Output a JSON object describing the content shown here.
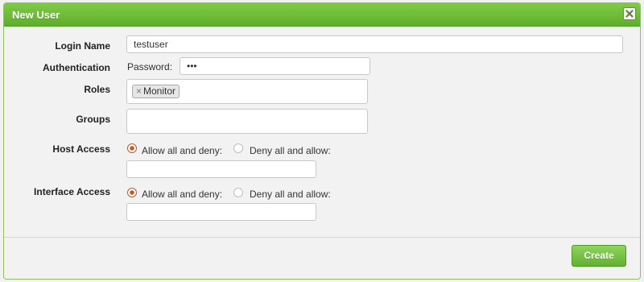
{
  "dialog": {
    "title": "New User",
    "close_icon": "close-icon"
  },
  "form": {
    "login_name": {
      "label": "Login Name",
      "value": "testuser"
    },
    "authentication": {
      "label": "Authentication",
      "password_label": "Password:",
      "password_value": "•••"
    },
    "roles": {
      "label": "Roles",
      "tags": [
        {
          "remove": "×",
          "text": "Monitor"
        }
      ]
    },
    "groups": {
      "label": "Groups",
      "value": ""
    },
    "host_access": {
      "label": "Host Access",
      "options": [
        {
          "text": "Allow all and deny:",
          "selected": true
        },
        {
          "text": "Deny all and allow:",
          "selected": false
        }
      ],
      "value": ""
    },
    "interface_access": {
      "label": "Interface Access",
      "options": [
        {
          "text": "Allow all and deny:",
          "selected": true
        },
        {
          "text": "Deny all and allow:",
          "selected": false
        }
      ],
      "value": ""
    }
  },
  "footer": {
    "create_label": "Create"
  },
  "colors": {
    "accent": "#6dbd36",
    "radio_selected": "#c8572a"
  }
}
